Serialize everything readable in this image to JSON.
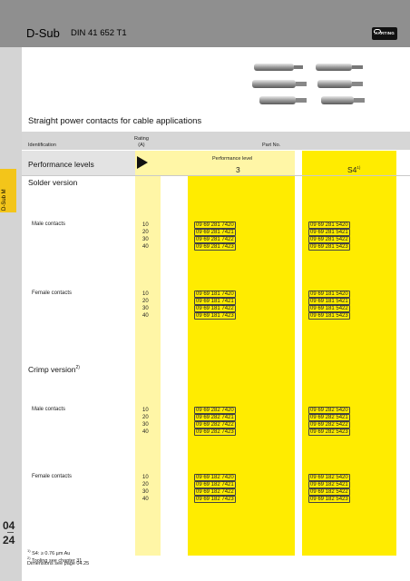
{
  "header": {
    "title": "D-Sub",
    "subtitle": "DIN 41 652 T1",
    "logo_text": "HARTING"
  },
  "sidebar": {
    "tab_label": "D-Sub M",
    "page_chapter": "04",
    "page_number": "24"
  },
  "intro": "Straight power contacts for cable applications",
  "table": {
    "identification_label": "Identification",
    "rating_label_line1": "Rating",
    "rating_label_line2": "(A)",
    "part_no_label": "Part No.",
    "performance_levels_label": "Performance levels",
    "performance_level_header": "Performance level",
    "level_3": "3",
    "level_s4": "S4",
    "level_s4_note": "1)",
    "sections": [
      {
        "title": "Solder version",
        "note": "",
        "groups": [
          {
            "name": "Male contacts",
            "ratings": [
              "10",
              "20",
              "30",
              "40"
            ],
            "pn3": [
              "09 69 281 7420",
              "09 69 281 7421",
              "09 69 281 7422",
              "09 69 281 7423"
            ],
            "pnS4": [
              "09 69 281 5420",
              "09 69 281 5421",
              "09 69 281 5422",
              "09 69 281 5423"
            ]
          },
          {
            "name": "Female contacts",
            "ratings": [
              "10",
              "20",
              "30",
              "40"
            ],
            "pn3": [
              "09 69 181 7420",
              "09 69 181 7421",
              "09 69 181 7422",
              "09 69 181 7423"
            ],
            "pnS4": [
              "09 69 181 5420",
              "09 69 181 5421",
              "09 69 181 5422",
              "09 69 181 5423"
            ]
          }
        ]
      },
      {
        "title": "Crimp version",
        "note": "2)",
        "groups": [
          {
            "name": "Male contacts",
            "ratings": [
              "10",
              "20",
              "30",
              "40"
            ],
            "pn3": [
              "09 69 282 7420",
              "09 69 282 7421",
              "09 69 282 7422",
              "09 69 282 7423"
            ],
            "pnS4": [
              "09 69 282 5420",
              "09 69 282 5421",
              "09 69 282 5422",
              "09 69 282 5423"
            ]
          },
          {
            "name": "Female contacts",
            "ratings": [
              "10",
              "20",
              "30",
              "40"
            ],
            "pn3": [
              "09 69 182 7420",
              "09 69 182 7421",
              "09 69 182 7422",
              "09 69 182 7423"
            ],
            "pnS4": [
              "09 69 182 5420",
              "09 69 182 5421",
              "09 69 182 5422",
              "09 69 182 5423"
            ]
          }
        ]
      }
    ]
  },
  "footnotes": {
    "fn1_mark": "1)",
    "fn1": "S4: ≥ 0.76 µm Au",
    "fn2_mark": "2)",
    "fn2": "Tooling see chapter 31",
    "fn3": "Dimensions see page 04.25"
  },
  "colors": {
    "header_gray": "#8f8f8f",
    "sidebar_gray": "#d4d4d4",
    "side_tab_yellow": "#f3c51a",
    "column_pale_yellow": "#fff6a6",
    "column_bright_yellow": "#ffec00"
  }
}
